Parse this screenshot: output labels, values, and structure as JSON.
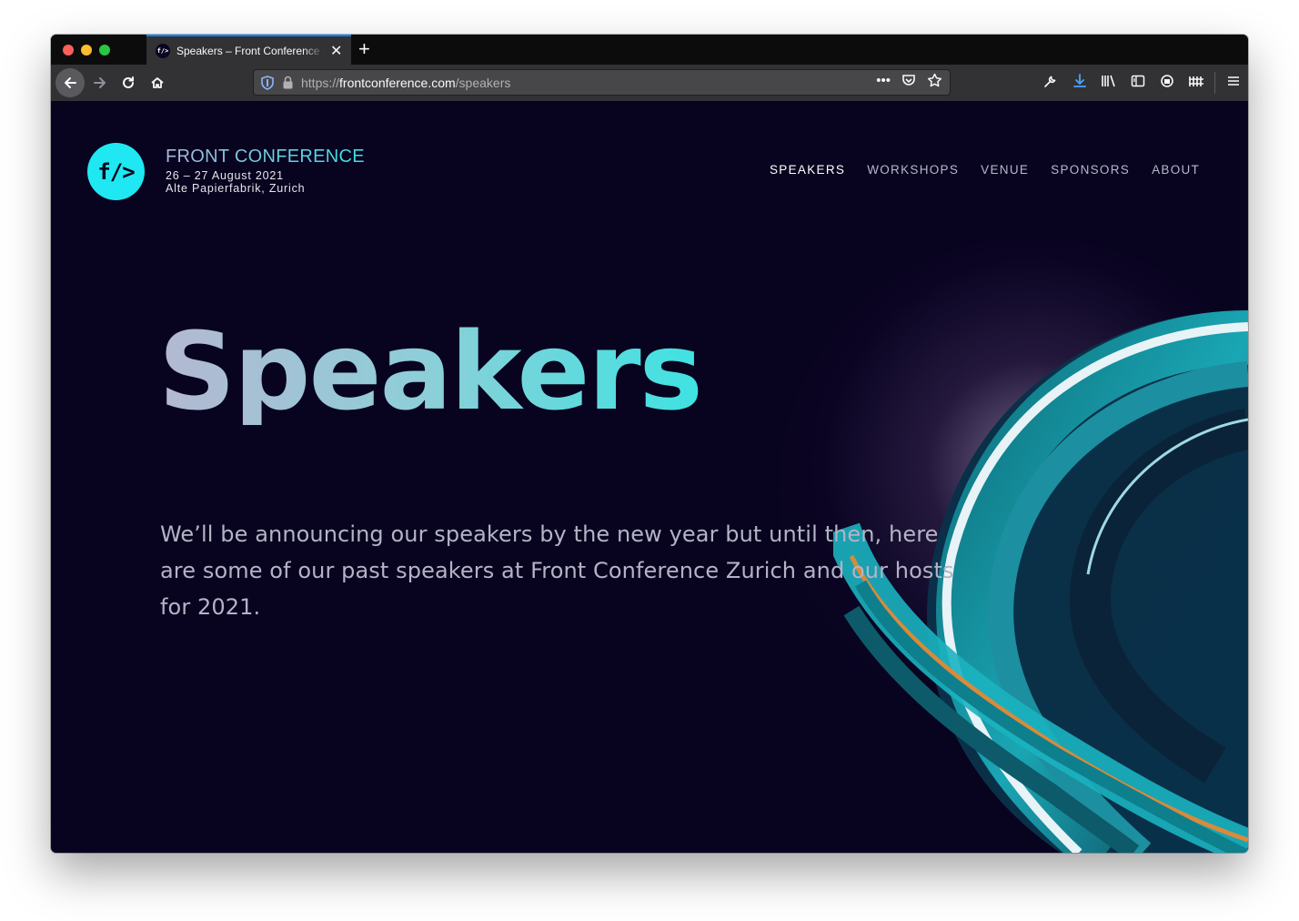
{
  "browser": {
    "tab_title": "Speakers – Front Conference Zurich",
    "tab_favicon": "f/>",
    "tab_close": "✕",
    "new_tab": "+",
    "url_scheme": "https://",
    "url_host": "frontconference.com",
    "url_path": "/speakers",
    "icons": [
      "back-icon",
      "forward-icon",
      "reload-icon",
      "home-icon",
      "shield-icon",
      "lock-icon",
      "page-actions-icon",
      "pocket-icon",
      "bookmark-star-icon",
      "wrench-icon",
      "download-icon",
      "library-icon",
      "sidebar-icon",
      "extension-icon",
      "extension2-icon",
      "menu-icon"
    ]
  },
  "site": {
    "logo": "f/>",
    "brand_name": "FRONT CONFERENCE",
    "date": "26 – 27 August 2021",
    "venue": "Alte Papierfabrik, Zurich",
    "nav": [
      "SPEAKERS",
      "WORKSHOPS",
      "VENUE",
      "SPONSORS",
      "ABOUT"
    ],
    "active_nav": "SPEAKERS",
    "accent_color": "#1fe8f2",
    "background_color": "#08031f"
  },
  "hero": {
    "title": "Speakers",
    "text": "We’ll be announcing our speakers by the new year but until then, here are some of our past speakers at Front Conference Zurich and our hosts for 2021."
  }
}
